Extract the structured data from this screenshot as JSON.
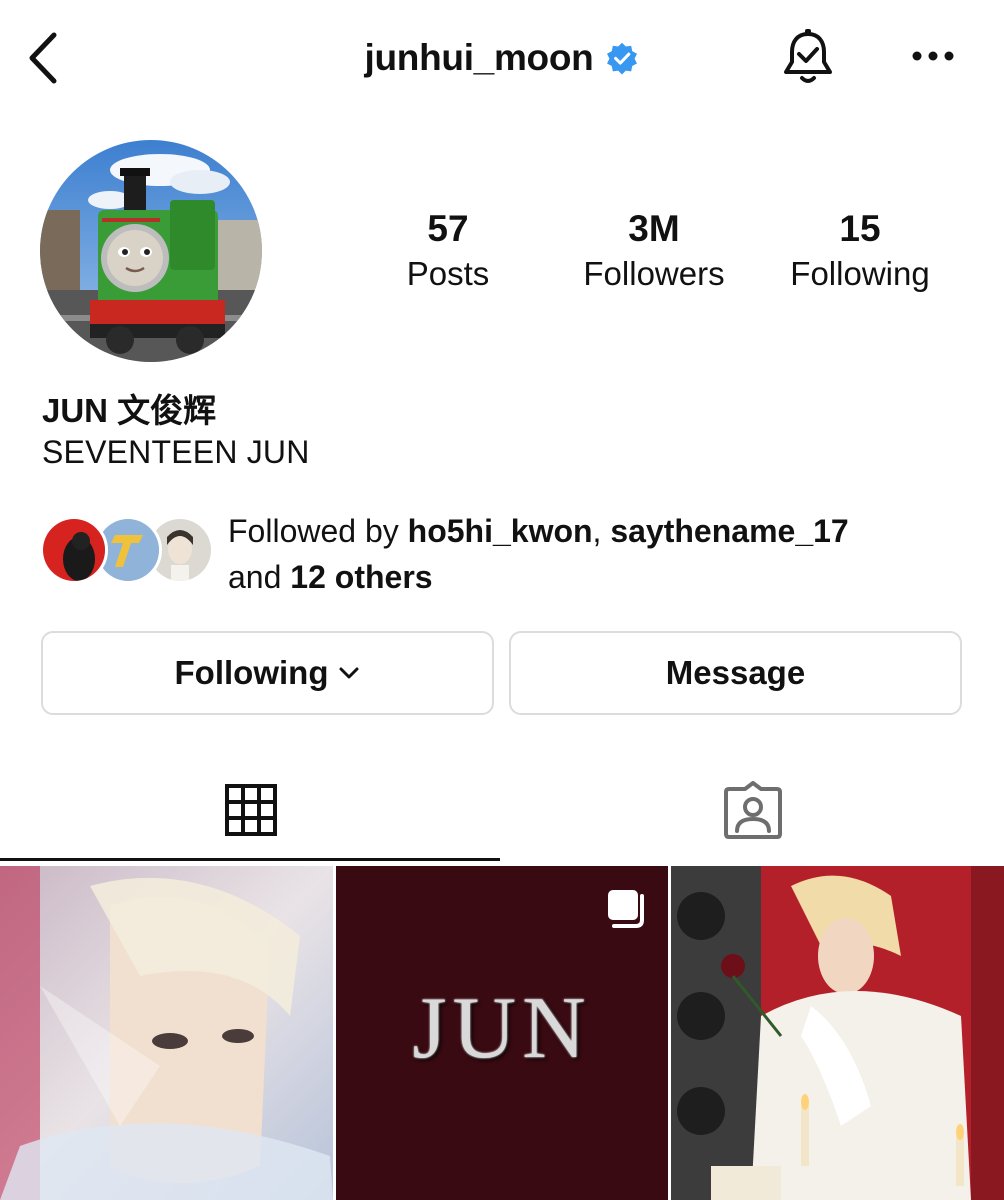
{
  "header": {
    "username": "junhui_moon",
    "verified": true,
    "icons": [
      "back-arrow-icon",
      "verified-badge-icon",
      "notification-bell-icon",
      "more-options-icon"
    ]
  },
  "profile": {
    "avatar_icon": "thomas-train-avatar",
    "display_name": "JUN 文俊辉",
    "bio": "SEVENTEEN JUN"
  },
  "stats": [
    {
      "value": "57",
      "label": "Posts"
    },
    {
      "value": "3M",
      "label": "Followers"
    },
    {
      "value": "15",
      "label": "Following"
    }
  ],
  "followed_by": {
    "prefix": "Followed by ",
    "user1": "ho5hi_kwon",
    "separator": ", ",
    "user2": "saythename_17",
    "and_text": "and ",
    "others": "12 others"
  },
  "buttons": {
    "following": "Following",
    "message": "Message"
  },
  "tabs": {
    "grid": "grid-icon",
    "tagged": "tagged-icon",
    "active": "grid"
  },
  "posts": {
    "post2_text": "JUN"
  },
  "colors": {
    "verified_blue": "#3897f0",
    "post2_bg": "#3a0a12",
    "border": "#dcdcdc"
  }
}
